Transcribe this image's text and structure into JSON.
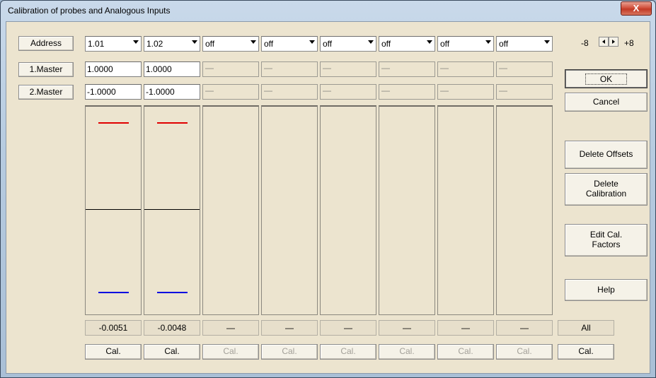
{
  "window": {
    "title": "Calibration of probes and Analogous Inputs",
    "close_glyph": "X"
  },
  "rows": {
    "address_label": "Address",
    "master1_label": "1.Master",
    "master2_label": "2.Master"
  },
  "channels": [
    {
      "address": "1.01",
      "master1": "1.0000",
      "master2": "-1.0000",
      "readout": "-0.0051",
      "cal": "Cal.",
      "active": true
    },
    {
      "address": "1.02",
      "master1": "1.0000",
      "master2": "-1.0000",
      "readout": "-0.0048",
      "cal": "Cal.",
      "active": true
    },
    {
      "address": "off",
      "master1": "—",
      "master2": "—",
      "readout": "—",
      "cal": "Cal.",
      "active": false
    },
    {
      "address": "off",
      "master1": "—",
      "master2": "—",
      "readout": "—",
      "cal": "Cal.",
      "active": false
    },
    {
      "address": "off",
      "master1": "—",
      "master2": "—",
      "readout": "—",
      "cal": "Cal.",
      "active": false
    },
    {
      "address": "off",
      "master1": "—",
      "master2": "—",
      "readout": "—",
      "cal": "Cal.",
      "active": false
    },
    {
      "address": "off",
      "master1": "—",
      "master2": "—",
      "readout": "—",
      "cal": "Cal.",
      "active": false
    },
    {
      "address": "off",
      "master1": "—",
      "master2": "—",
      "readout": "—",
      "cal": "Cal.",
      "active": false
    }
  ],
  "range": {
    "min_label": "-8",
    "max_label": "+8"
  },
  "buttons": {
    "ok": "OK",
    "cancel": "Cancel",
    "delete_offsets": "Delete Offsets",
    "delete_calibration_l1": "Delete",
    "delete_calibration_l2": "Calibration",
    "edit_factors_l1": "Edit Cal.",
    "edit_factors_l2": "Factors",
    "help": "Help",
    "all": "All",
    "cal_all": "Cal."
  },
  "colors": {
    "upper_marker": "#e00000",
    "lower_marker": "#0000e0",
    "zero_line": "#000000"
  }
}
